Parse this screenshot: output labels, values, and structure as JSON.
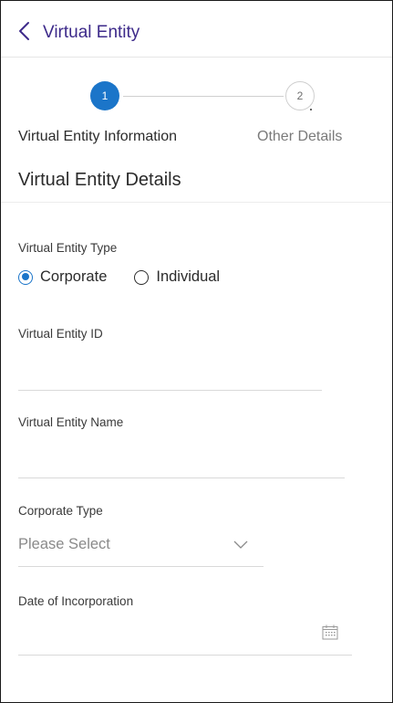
{
  "header": {
    "title": "Virtual Entity",
    "back_icon": "chevron-left-icon"
  },
  "stepper": {
    "steps": [
      {
        "number": "1",
        "label": "Virtual Entity Information",
        "active": true
      },
      {
        "number": "2",
        "label": "Other Details",
        "active": false
      }
    ]
  },
  "section": {
    "title": "Virtual Entity Details"
  },
  "form": {
    "entity_type": {
      "label": "Virtual Entity Type",
      "options": [
        "Corporate",
        "Individual"
      ],
      "selected": "Corporate"
    },
    "entity_id": {
      "label": "Virtual Entity ID",
      "value": ""
    },
    "entity_name": {
      "label": "Virtual Entity Name",
      "value": ""
    },
    "corporate_type": {
      "label": "Corporate Type",
      "value": "Please Select",
      "icon": "chevron-down-icon"
    },
    "date_of_incorporation": {
      "label": "Date of Incorporation",
      "value": "",
      "icon": "calendar-icon"
    }
  },
  "colors": {
    "accent": "#1b75c9",
    "header_title": "#3d2a8a",
    "divider": "#d9d9d9"
  }
}
